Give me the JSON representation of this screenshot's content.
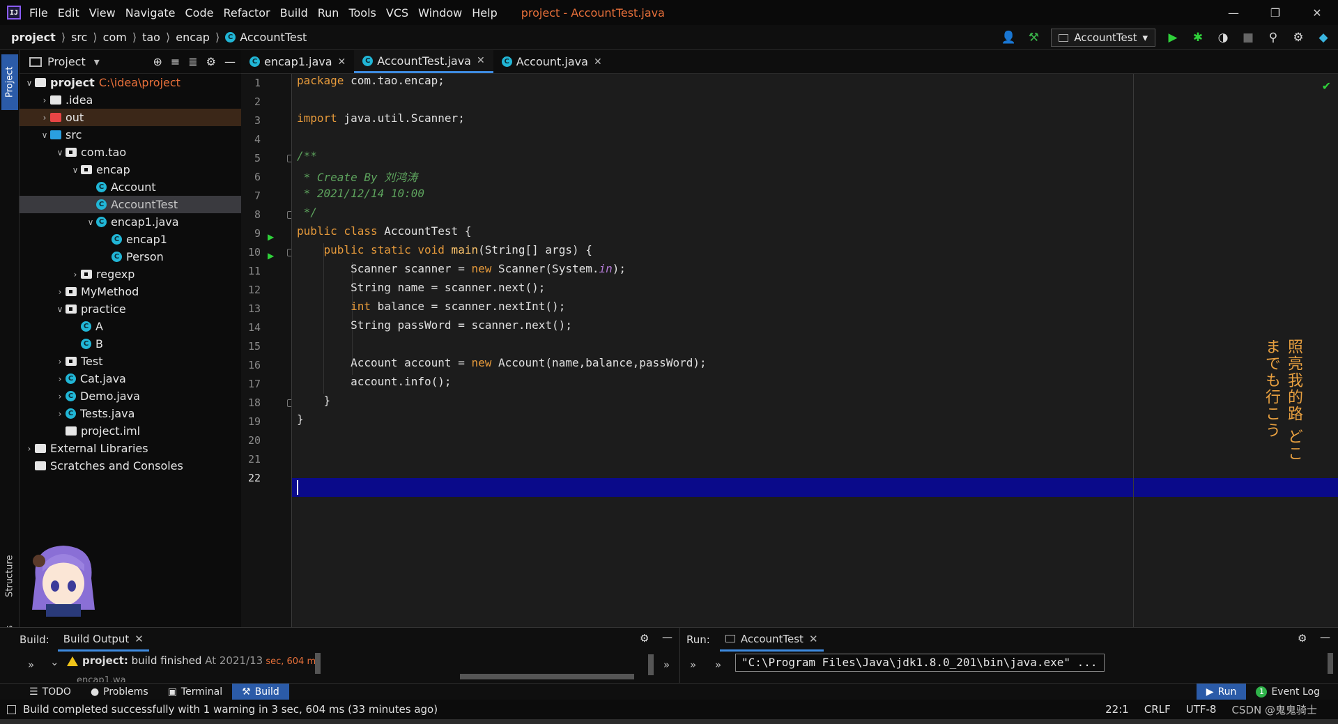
{
  "menubar": {
    "items": [
      "File",
      "Edit",
      "View",
      "Navigate",
      "Code",
      "Refactor",
      "Build",
      "Run",
      "Tools",
      "VCS",
      "Window",
      "Help"
    ],
    "title": "project - AccountTest.java"
  },
  "navbar": {
    "crumbs": [
      "project",
      "src",
      "com",
      "tao",
      "encap"
    ],
    "file": "AccountTest",
    "run_config": "AccountTest"
  },
  "stripe": {
    "project": "Project",
    "structure": "Structure",
    "favorites": "Favorites"
  },
  "project_panel": {
    "title": "Project",
    "tree": [
      {
        "label": "project",
        "extra": "C:\\idea\\project",
        "indent": 0,
        "arrow": "v",
        "icon": "folder-white"
      },
      {
        "label": ".idea",
        "indent": 1,
        "arrow": ">",
        "icon": "folder-white"
      },
      {
        "label": "out",
        "indent": 1,
        "arrow": ">",
        "icon": "folder-red"
      },
      {
        "label": "src",
        "indent": 1,
        "arrow": "v",
        "icon": "folder-blue"
      },
      {
        "label": "com.tao",
        "indent": 2,
        "arrow": "v",
        "icon": "package"
      },
      {
        "label": "encap",
        "indent": 3,
        "arrow": "v",
        "icon": "package"
      },
      {
        "label": "Account",
        "indent": 4,
        "arrow": "",
        "icon": "class"
      },
      {
        "label": "AccountTest",
        "indent": 4,
        "arrow": "",
        "icon": "class"
      },
      {
        "label": "encap1.java",
        "indent": 4,
        "arrow": "v",
        "icon": "class"
      },
      {
        "label": "encap1",
        "indent": 5,
        "arrow": "",
        "icon": "class"
      },
      {
        "label": "Person",
        "indent": 5,
        "arrow": "",
        "icon": "class"
      },
      {
        "label": "regexp",
        "indent": 3,
        "arrow": ">",
        "icon": "package"
      },
      {
        "label": "MyMethod",
        "indent": 2,
        "arrow": ">",
        "icon": "package"
      },
      {
        "label": "practice",
        "indent": 2,
        "arrow": "v",
        "icon": "package"
      },
      {
        "label": "A",
        "indent": 3,
        "arrow": "",
        "icon": "class"
      },
      {
        "label": "B",
        "indent": 3,
        "arrow": "",
        "icon": "class"
      },
      {
        "label": "Test",
        "indent": 2,
        "arrow": ">",
        "icon": "package"
      },
      {
        "label": "Cat.java",
        "indent": 2,
        "arrow": ">",
        "icon": "class"
      },
      {
        "label": "Demo.java",
        "indent": 2,
        "arrow": ">",
        "icon": "class"
      },
      {
        "label": "Tests.java",
        "indent": 2,
        "arrow": ">",
        "icon": "class"
      },
      {
        "label": "project.iml",
        "indent": 2,
        "arrow": "",
        "icon": "file"
      },
      {
        "label": "External Libraries",
        "indent": 0,
        "arrow": ">",
        "icon": "library"
      },
      {
        "label": "Scratches and Consoles",
        "indent": 0,
        "arrow": "",
        "icon": "scratch"
      }
    ]
  },
  "editor_tabs": [
    {
      "label": "encap1.java",
      "active": false
    },
    {
      "label": "AccountTest.java",
      "active": true
    },
    {
      "label": "Account.java",
      "active": false
    }
  ],
  "code": {
    "line_numbers": [
      "1",
      "2",
      "3",
      "4",
      "5",
      "6",
      "7",
      "8",
      "9",
      "10",
      "11",
      "12",
      "13",
      "14",
      "15",
      "16",
      "17",
      "18",
      "19",
      "20",
      "21",
      "22"
    ],
    "current_line": "22",
    "l1_kw": "package",
    "l1_rest": " com.tao.encap;",
    "l3_kw": "import",
    "l3_rest": " java.util.Scanner;",
    "l5": "/**",
    "l6": " * Create By 刘鸿涛",
    "l7": " * 2021/12/14 10:00",
    "l8": " */",
    "l9_kw": "public class",
    "l9_rest": " AccountTest {",
    "l10_kw": "    public static void",
    "l10_fn": " main",
    "l10_rest": "(String[] args) {",
    "l11_a": "        Scanner scanner = ",
    "l11_kw": "new",
    "l11_b": " Scanner(System.",
    "l11_fld": "in",
    "l11_c": ");",
    "l12": "        String name = scanner.next();",
    "l13_kw": "        int",
    "l13_rest": " balance = scanner.nextInt();",
    "l14": "        String passWord = scanner.next();",
    "l16_a": "        Account account = ",
    "l16_kw": "new",
    "l16_b": " Account(name,balance,passWord);",
    "l17": "        account.info();",
    "l18": "    }",
    "l19": "}",
    "side_text": "照亮我的路 どこまでも行こう"
  },
  "build_panel": {
    "label": "Build:",
    "tab": "Build Output",
    "project": "project:",
    "message": " build finished",
    "time": " At 2021/13",
    "duration": " sec, 604 ms",
    "cut_line": "encap1.wa"
  },
  "run_panel": {
    "label": "Run:",
    "tab": "AccountTest",
    "console_line": "\"C:\\Program Files\\Java\\jdk1.8.0_201\\bin\\java.exe\" ..."
  },
  "toolwindows": {
    "todo": "TODO",
    "problems": "Problems",
    "terminal": "Terminal",
    "build": "Build",
    "run": "Run",
    "event_log": "Event Log",
    "event_count": "1"
  },
  "status": {
    "message": "Build completed successfully with 1 warning in 3 sec, 604 ms (33 minutes ago)",
    "position": "22:1",
    "line_sep": "CRLF",
    "encoding": "UTF-8",
    "watermark": "CSDN @鬼鬼骑士"
  },
  "colors": {
    "accent": "#3e8be0",
    "keyword": "#e69a3b",
    "comment": "#5da35d",
    "current_line": "#0a0a8a",
    "title_orange": "#e8703a"
  }
}
